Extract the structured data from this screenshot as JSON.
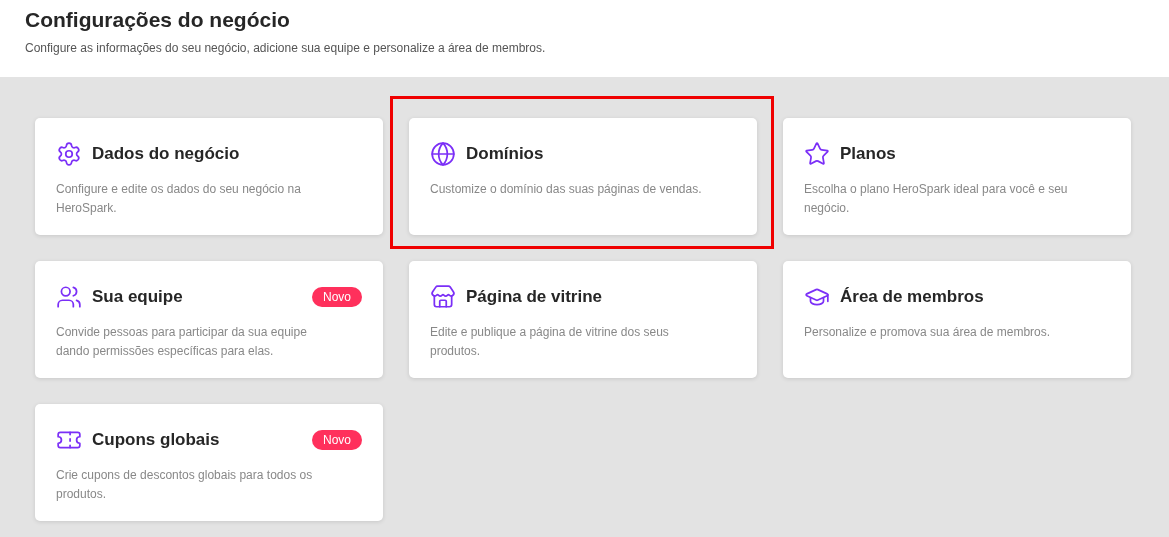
{
  "header": {
    "title": "Configurações do negócio",
    "subtitle": "Configure as informações do seu negócio, adicione sua equipe e personalize a área de membros."
  },
  "cards": [
    {
      "title": "Dados do negócio",
      "description": "Configure e edite os dados do seu negócio na HeroSpark.",
      "highlighted": false
    },
    {
      "title": "Domínios",
      "description": "Customize o domínio das suas páginas de vendas.",
      "highlighted": true
    },
    {
      "title": "Planos",
      "description": "Escolha o plano HeroSpark ideal para você e seu negócio.",
      "highlighted": false
    },
    {
      "title": "Sua equipe",
      "badge": "Novo",
      "description": "Convide pessoas para participar da sua equipe dando permissões específicas para elas.",
      "highlighted": false
    },
    {
      "title": "Página de vitrine",
      "description": "Edite e publique a página de vitrine dos seus produtos.",
      "highlighted": false
    },
    {
      "title": "Área de membros",
      "description": "Personalize e promova sua área de membros.",
      "highlighted": false
    },
    {
      "title": "Cupons globais",
      "badge": "Novo",
      "description": "Crie cupons de descontos globais para todos os produtos.",
      "highlighted": false
    }
  ]
}
